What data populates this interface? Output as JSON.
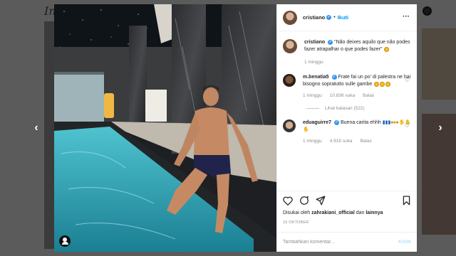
{
  "background": {
    "logo_text": "In"
  },
  "nav": {
    "prev_symbol": "‹",
    "next_symbol": "›"
  },
  "post": {
    "username": "cristiano",
    "follow_label": "Ikuti",
    "more_symbol": "···",
    "caption": "\"Não deixes aquilo que não podes fazer atrapalhar o que podes fazer\"",
    "caption_time": "1 minggu",
    "liked_by_prefix": "Disukai oleh ",
    "liked_by_user": "zahrakiani_official",
    "liked_by_suffix": " dan ",
    "liked_by_others": "lainnya",
    "date": "16 OKTOBER",
    "comment_placeholder": "Tambahkan komentar...",
    "post_button": "Kirim"
  },
  "comments": [
    {
      "username": "m.benatia5",
      "text": "Frate fai un po' di palestra ne hai bisogno sopratutto sulle gambe",
      "time": "1 minggu",
      "likes": "10.836 suka",
      "reply_label": "Balas",
      "view_replies": "Lihat balasan (522)"
    },
    {
      "username": "eduaguirre7",
      "text": "Buena carita ehhh",
      "time": "1 minggu",
      "likes": "4.918 suka",
      "reply_label": "Balas"
    }
  ],
  "colors": {
    "accent": "#0095f6",
    "verified": "#3897f0",
    "muted": "#8e8e8e",
    "pool": "#2fa7b9"
  },
  "icons": [
    "heart-icon",
    "comment-icon",
    "share-icon",
    "bookmark-icon",
    "user-tag-icon",
    "more-icon",
    "verified-icon"
  ]
}
